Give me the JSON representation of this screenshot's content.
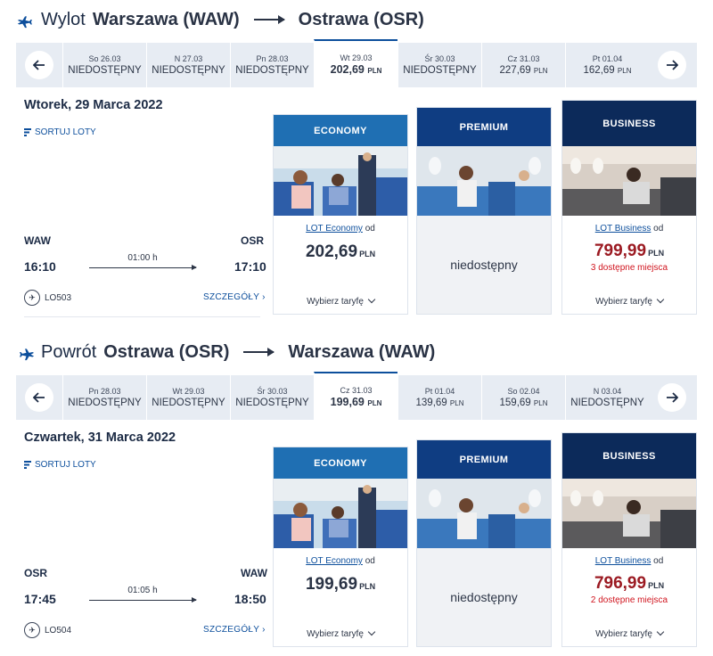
{
  "outbound": {
    "direction": "Wylot",
    "from_city": "Warszawa (WAW)",
    "to_city": "Ostrawa (OSR)",
    "days": [
      {
        "label": "So 26.03",
        "value": "NIEDOSTĘPNY",
        "currency": ""
      },
      {
        "label": "N 27.03",
        "value": "NIEDOSTĘPNY",
        "currency": ""
      },
      {
        "label": "Pn 28.03",
        "value": "NIEDOSTĘPNY",
        "currency": ""
      },
      {
        "label": "Wt 29.03",
        "value": "202,69",
        "currency": "PLN"
      },
      {
        "label": "Śr 30.03",
        "value": "NIEDOSTĘPNY",
        "currency": ""
      },
      {
        "label": "Cz 31.03",
        "value": "227,69",
        "currency": "PLN"
      },
      {
        "label": "Pt 01.04",
        "value": "162,69",
        "currency": "PLN"
      }
    ],
    "date": "Wtorek, 29 Marca 2022",
    "sort_label": "SORTUJ LOTY",
    "origin": "WAW",
    "destination": "OSR",
    "dep_time": "16:10",
    "arr_time": "17:10",
    "duration": "01:00 h",
    "flight_no": "LO503",
    "details": "SZCZEGÓŁY ›",
    "economy": {
      "head": "ECONOMY",
      "link": "LOT Economy",
      "od": "od",
      "price": "202,69",
      "currency": "PLN",
      "tariff": "Wybierz taryfę"
    },
    "premium": {
      "head": "PREMIUM",
      "status": "niedostępny"
    },
    "business": {
      "head": "BUSINESS",
      "link": "LOT Business",
      "od": "od",
      "price": "799,99",
      "currency": "PLN",
      "seats": "3 dostępne miejsca",
      "tariff": "Wybierz taryfę"
    }
  },
  "return": {
    "direction": "Powrót",
    "from_city": "Ostrawa (OSR)",
    "to_city": "Warszawa (WAW)",
    "days": [
      {
        "label": "Pn 28.03",
        "value": "NIEDOSTĘPNY",
        "currency": ""
      },
      {
        "label": "Wt 29.03",
        "value": "NIEDOSTĘPNY",
        "currency": ""
      },
      {
        "label": "Śr 30.03",
        "value": "NIEDOSTĘPNY",
        "currency": ""
      },
      {
        "label": "Cz 31.03",
        "value": "199,69",
        "currency": "PLN"
      },
      {
        "label": "Pt 01.04",
        "value": "139,69",
        "currency": "PLN"
      },
      {
        "label": "So 02.04",
        "value": "159,69",
        "currency": "PLN"
      },
      {
        "label": "N 03.04",
        "value": "NIEDOSTĘPNY",
        "currency": ""
      }
    ],
    "date": "Czwartek, 31 Marca 2022",
    "sort_label": "SORTUJ LOTY",
    "origin": "OSR",
    "destination": "WAW",
    "dep_time": "17:45",
    "arr_time": "18:50",
    "duration": "01:05 h",
    "flight_no": "LO504",
    "details": "SZCZEGÓŁY ›",
    "economy": {
      "head": "ECONOMY",
      "link": "LOT Economy",
      "od": "od",
      "price": "199,69",
      "currency": "PLN",
      "tariff": "Wybierz taryfę"
    },
    "premium": {
      "head": "PREMIUM",
      "status": "niedostępny"
    },
    "business": {
      "head": "BUSINESS",
      "link": "LOT Business",
      "od": "od",
      "price": "796,99",
      "currency": "PLN",
      "seats": "2 dostępne miejsca",
      "tariff": "Wybierz taryfę"
    }
  },
  "colors": {
    "accent": "#0d4f9c",
    "economy": "#1f6fb3",
    "premium": "#0f3d82",
    "business": "#0c2a5a",
    "seats": "#d0151f",
    "strip": "#e7ecf3"
  }
}
